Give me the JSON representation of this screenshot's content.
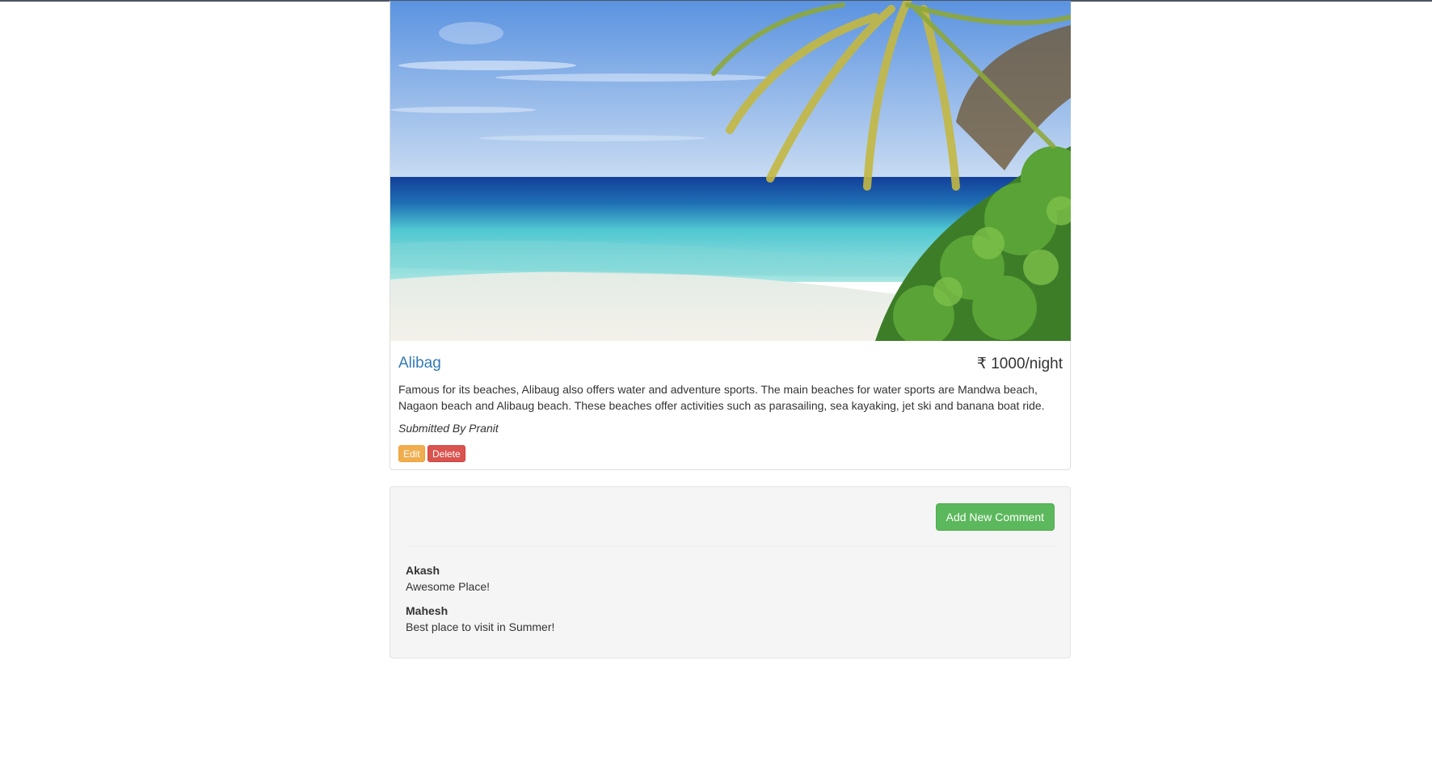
{
  "colors": {
    "link": "#337ab7",
    "edit_button": "#f0ad4e",
    "delete_button": "#d9534f",
    "add_comment_button": "#5cb85c",
    "well_background": "#f5f5f5"
  },
  "campground": {
    "image_alt": "beach-with-palm-tree",
    "name": "Alibag",
    "price": "₹ 1000/night",
    "description": "Famous for its beaches, Alibaug also offers water and adventure sports. The main beaches for water sports are Mandwa beach, Nagaon beach and Alibaug beach. These beaches offer activities such as parasailing, sea kayaking, jet ski and banana boat ride.",
    "submitted_by": "Submitted By Pranit",
    "edit_label": "Edit",
    "delete_label": "Delete"
  },
  "comments_section": {
    "add_button_label": "Add New Comment",
    "comments": [
      {
        "author": "Akash",
        "text": "Awesome Place!"
      },
      {
        "author": "Mahesh",
        "text": "Best place to visit in Summer!"
      }
    ]
  }
}
